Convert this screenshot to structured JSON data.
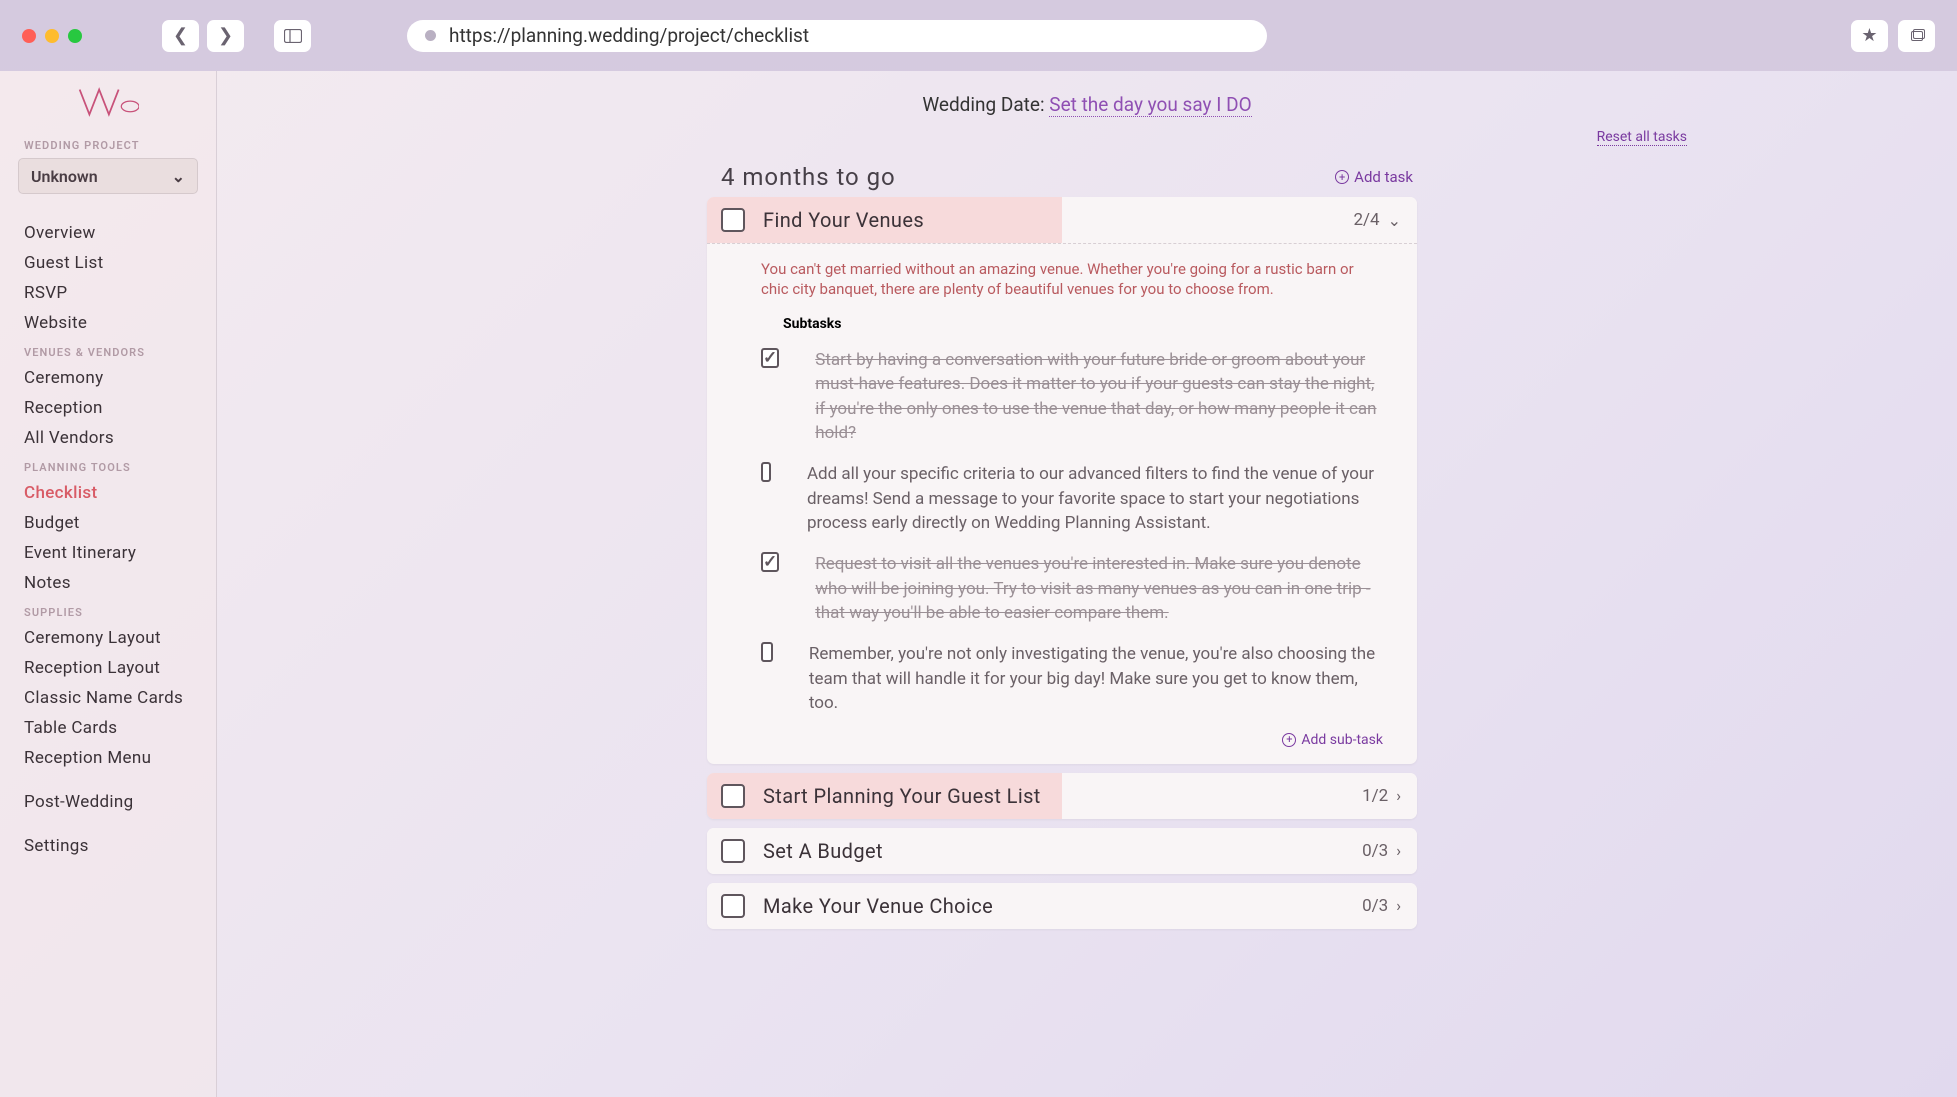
{
  "browser": {
    "url": "https://planning.wedding/project/checklist"
  },
  "sidebar": {
    "label_project": "WEDDING PROJECT",
    "project_name": "Unknown",
    "groups": [
      {
        "label": null,
        "items": [
          "Overview",
          "Guest List",
          "RSVP",
          "Website"
        ]
      },
      {
        "label": "VENUES & VENDORS",
        "items": [
          "Ceremony",
          "Reception",
          "All Vendors"
        ]
      },
      {
        "label": "PLANNING TOOLS",
        "items": [
          "Checklist",
          "Budget",
          "Event Itinerary",
          "Notes"
        ],
        "active": "Checklist"
      },
      {
        "label": "SUPPLIES",
        "items": [
          "Ceremony Layout",
          "Reception Layout",
          "Classic Name Cards",
          "Table Cards",
          "Reception Menu"
        ]
      },
      {
        "label": null,
        "items": [
          "Post-Wedding"
        ]
      },
      {
        "label": null,
        "items": [
          "Settings"
        ]
      }
    ]
  },
  "header": {
    "date_prefix": "Wedding Date: ",
    "date_link": "Set the day you say I DO",
    "reset": "Reset all tasks"
  },
  "bucket": {
    "title": "4 months to go",
    "add_task": "Add task"
  },
  "add_sub_label": "Add sub-task",
  "subtasks_label": "Subtasks",
  "tasks": [
    {
      "title": "Find Your Venues",
      "counter": "2/4",
      "expanded": true,
      "half": true,
      "blurb": "You can't get married without an amazing venue. Whether you're going for a rustic barn or chic city banquet, there are plenty of beautiful venues for you to choose from.",
      "subs": [
        {
          "done": true,
          "text": "Start by having a conversation with your future bride or groom about your must-have features. Does it matter to you if your guests can stay the night, if you're the only ones to use the venue that day, or how many people it can hold?"
        },
        {
          "done": false,
          "text": "Add all your specific criteria to our advanced filters to find the venue of your dreams! Send a message to your favorite space to start your negotiations process early directly on Wedding Planning Assistant."
        },
        {
          "done": true,
          "text": "Request to visit all the venues you're interested in. Make sure you denote who will be joining you. Try to visit as many venues as you can in one trip - that way you'll be able to easier compare them."
        },
        {
          "done": false,
          "text": "Remember, you're not only investigating the venue, you're also choosing the team that will handle it for your big day! Make sure you get to know them, too."
        }
      ]
    },
    {
      "title": "Start Planning Your Guest List",
      "counter": "1/2",
      "half": true
    },
    {
      "title": "Set A Budget",
      "counter": "0/3",
      "half": false
    },
    {
      "title": "Make Your Venue Choice",
      "counter": "0/3",
      "half": false
    }
  ]
}
